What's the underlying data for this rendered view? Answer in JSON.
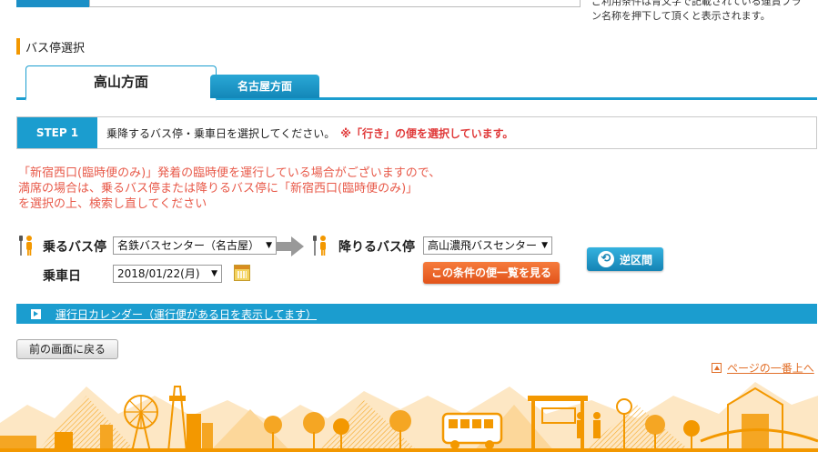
{
  "top_note": "ご利用条件は青文字で記載されている運賃プラン名称を押下して頂くと表示されます。",
  "section": {
    "title": "バス停選択"
  },
  "tabs": [
    {
      "label": "高山方面",
      "active": true
    },
    {
      "label": "名古屋方面",
      "active": false
    }
  ],
  "step": {
    "label": "STEP 1",
    "text": "乗降するバス停・乗車日を選択してください。",
    "note": "※「行き」の便を選択しています。"
  },
  "notice": [
    "「新宿西口(臨時便のみ)」発着の臨時便を運行している場合がございますので、",
    "満席の場合は、乗るバス停または降りるバス停に「新宿西口(臨時便のみ)」",
    "を選択の上、検索し直してください"
  ],
  "form": {
    "board_label": "乗るバス停",
    "board_value": "名鉄バスセンター（名古屋）",
    "alight_label": "降りるバス停",
    "alight_value": "高山濃飛バスセンター",
    "date_label": "乗車日",
    "date_value": "2018/01/22(月)",
    "search_button": "この条件の便一覧を見る",
    "reverse_button": "逆区間"
  },
  "calendar_link": "運行日カレンダー（運行便がある日を表示してます）",
  "back_button": "前の画面に戻る",
  "pagetop_link": "ページの一番上へ",
  "colors": {
    "accent_blue": "#1b9dcf",
    "accent_orange": "#f39800",
    "notice_red": "#e85a4a",
    "search_orange": "#e2531a"
  }
}
